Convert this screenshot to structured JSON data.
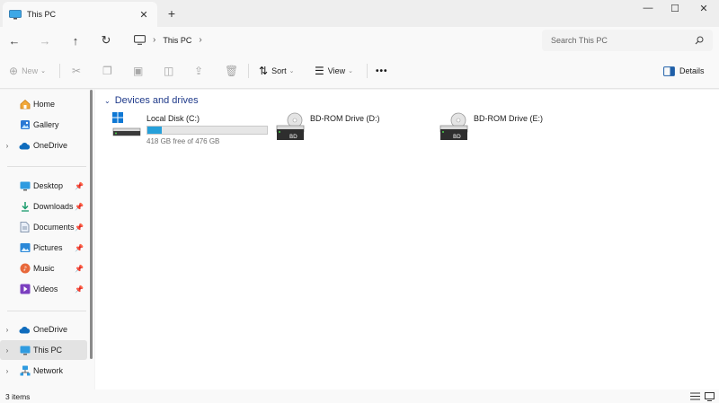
{
  "window": {
    "tab_title": "This PC",
    "tab_close": "✕",
    "new_tab": "+",
    "controls": {
      "minimize": "—",
      "maximize": "☐",
      "close": "✕"
    }
  },
  "address": {
    "back": "←",
    "forward": "→",
    "up": "↑",
    "refresh": "↻",
    "crumbs": [
      "This PC"
    ],
    "separator": "›",
    "search_placeholder": "Search This PC"
  },
  "commands": {
    "new": "New",
    "sort": "Sort",
    "view": "View",
    "more": "•••",
    "details": "Details"
  },
  "sidebar": {
    "items": [
      {
        "label": "Home",
        "icon": "home-icon"
      },
      {
        "label": "Gallery",
        "icon": "gallery-icon"
      },
      {
        "label": "OneDrive",
        "icon": "cloud-icon",
        "expandable": true
      },
      {
        "label": "Desktop",
        "icon": "desktop-icon",
        "pinned": true
      },
      {
        "label": "Downloads",
        "icon": "downloads-icon",
        "pinned": true
      },
      {
        "label": "Documents",
        "icon": "documents-icon",
        "pinned": true
      },
      {
        "label": "Pictures",
        "icon": "pictures-icon",
        "pinned": true
      },
      {
        "label": "Music",
        "icon": "music-icon",
        "pinned": true
      },
      {
        "label": "Videos",
        "icon": "videos-icon",
        "pinned": true
      },
      {
        "label": "OneDrive",
        "icon": "cloud-icon",
        "expandable": true
      },
      {
        "label": "This PC",
        "icon": "computer-icon",
        "expandable": true,
        "selected": true
      },
      {
        "label": "Network",
        "icon": "network-icon",
        "expandable": true
      }
    ]
  },
  "content": {
    "group_title": "Devices and drives",
    "drives": [
      {
        "name": "Local Disk (C:)",
        "free_text": "418 GB free of 476 GB",
        "used_fraction": 0.12,
        "icon": "windows-drive-icon"
      },
      {
        "name": "BD-ROM Drive (D:)",
        "icon": "bd-rom-drive-icon",
        "badge": "BD"
      },
      {
        "name": "BD-ROM Drive (E:)",
        "icon": "bd-rom-drive-icon",
        "badge": "BD"
      }
    ]
  },
  "status": {
    "item_count": "3 items"
  },
  "colors": {
    "accent": "#26a0da",
    "group_header": "#1f3a8a",
    "selected": "#e3e3e3"
  }
}
